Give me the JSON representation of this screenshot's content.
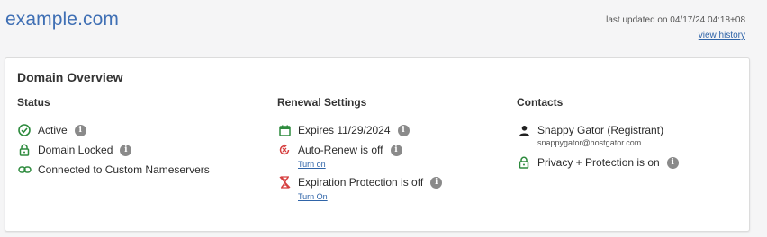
{
  "header": {
    "domain": "example.com",
    "last_updated": "last updated on 04/17/24 04:18+08",
    "view_history": "view history"
  },
  "card": {
    "title": "Domain Overview",
    "status": {
      "title": "Status",
      "items": [
        {
          "label": "Active"
        },
        {
          "label": "Domain Locked"
        },
        {
          "label": "Connected to Custom Nameservers"
        }
      ]
    },
    "renewal": {
      "title": "Renewal Settings",
      "expires": "Expires 11/29/2024",
      "auto_renew": "Auto-Renew is off",
      "auto_renew_link": "Turn on",
      "expiration_protection": "Expiration Protection is off",
      "expiration_protection_link": "Turn On"
    },
    "contacts": {
      "title": "Contacts",
      "registrant": "Snappy Gator (Registrant)",
      "registrant_email": "snappygator@hostgator.com",
      "privacy": "Privacy + Protection is on"
    }
  },
  "colors": {
    "green": "#2e8b3e",
    "red": "#d64040",
    "link": "#2f64a8",
    "title": "#3f6fb4",
    "info_gray": "#8a8a8a"
  }
}
